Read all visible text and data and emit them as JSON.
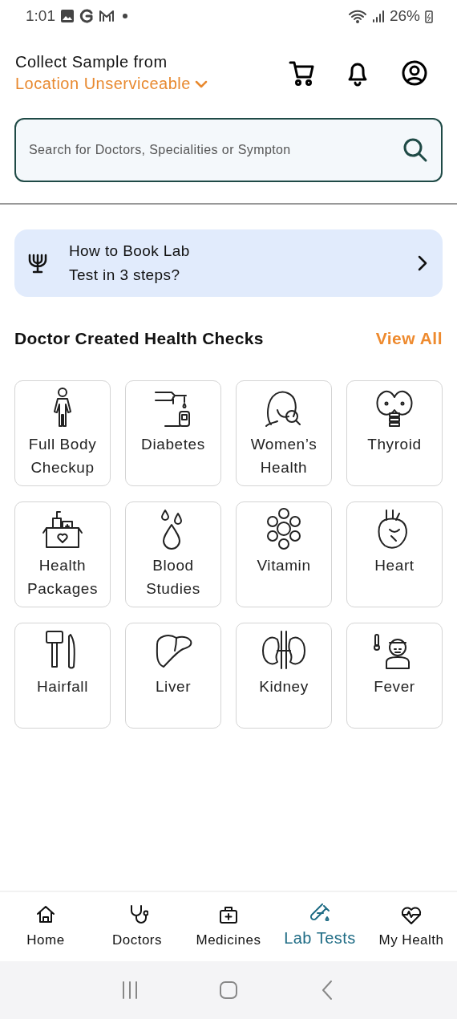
{
  "status_bar": {
    "time": "1:01",
    "battery": "26%"
  },
  "header": {
    "label": "Collect Sample from",
    "location": "Location Unserviceable"
  },
  "search": {
    "placeholder": "Search for Doctors, Specialities or Sympton"
  },
  "banner": {
    "text": "How to Book Lab Test in 3 steps?"
  },
  "section": {
    "title": "Doctor Created Health Checks",
    "action": "View All"
  },
  "health_checks": [
    {
      "label": "Full Body Checkup"
    },
    {
      "label": "Diabetes"
    },
    {
      "label": "Women’s Health"
    },
    {
      "label": "Thyroid"
    },
    {
      "label": "Health Packages"
    },
    {
      "label": "Blood Studies"
    },
    {
      "label": "Vitamin"
    },
    {
      "label": "Heart"
    },
    {
      "label": "Hairfall"
    },
    {
      "label": "Liver"
    },
    {
      "label": "Kidney"
    },
    {
      "label": "Fever"
    }
  ],
  "bottom_nav": [
    {
      "label": "Home",
      "selected": false
    },
    {
      "label": "Doctors",
      "selected": false
    },
    {
      "label": "Medicines",
      "selected": false
    },
    {
      "label": "Lab Tests",
      "selected": true
    },
    {
      "label": "My Health",
      "selected": false
    }
  ]
}
